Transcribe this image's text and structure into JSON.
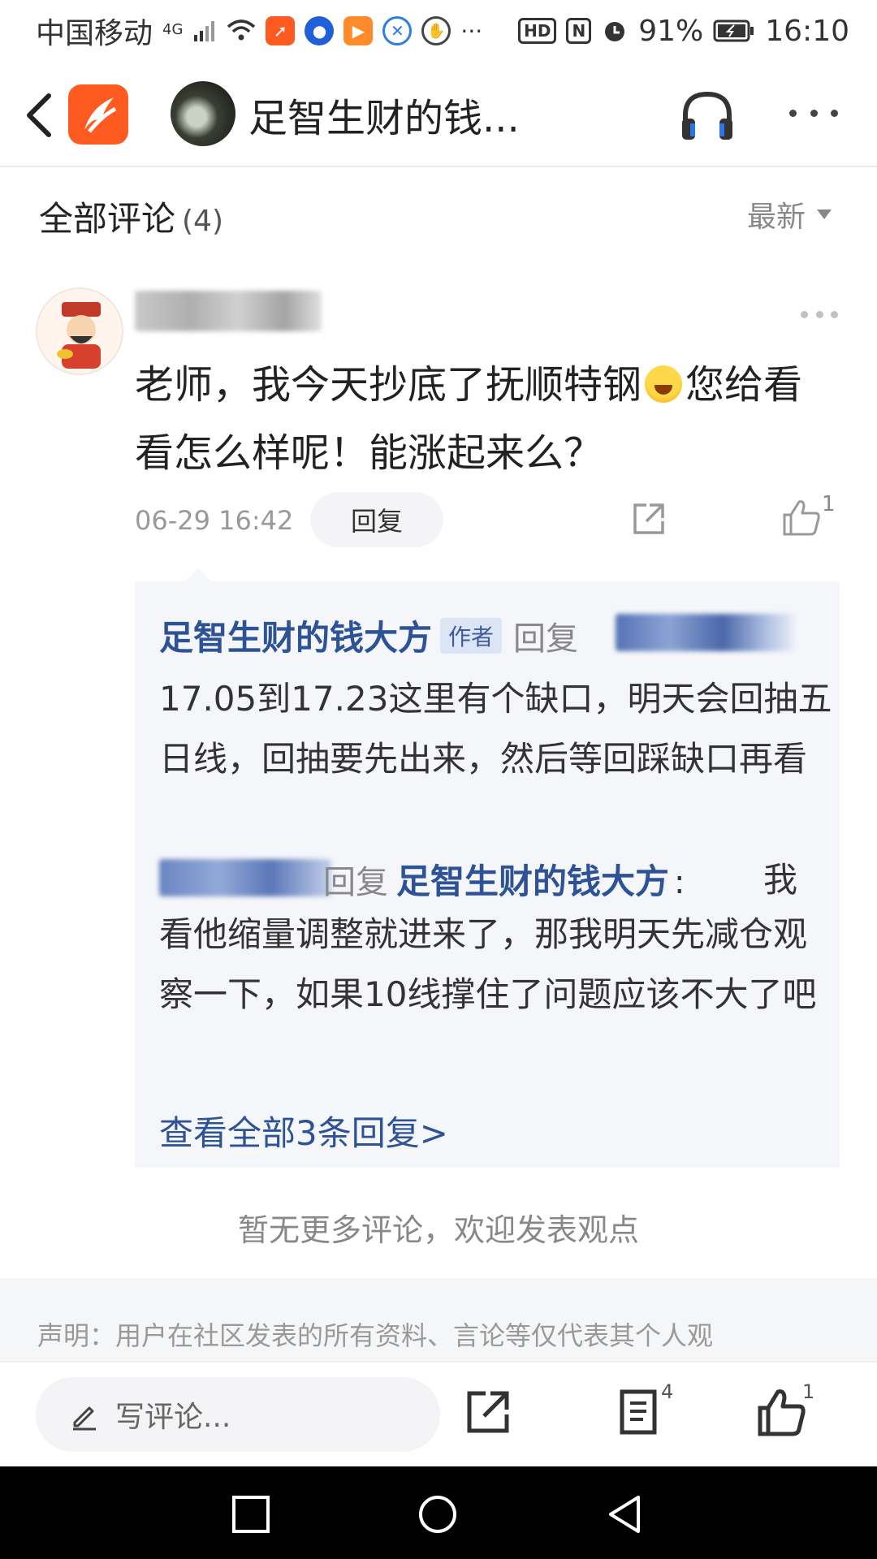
{
  "status_bar": {
    "carrier": "中国移动",
    "network": "4G",
    "more": "···",
    "hd_badge": "HD",
    "battery": "91%",
    "time": "16:10"
  },
  "nav": {
    "title": "足智生财的钱..."
  },
  "comments": {
    "header": "全部评论",
    "count": "(4)",
    "sort_label": "最新"
  },
  "comment": {
    "text_part1": "老师，我今天抄底了抚顺特钢",
    "text_part2": "您给看看怎么样呢！能涨起来么？",
    "time": "06-29 16:42",
    "reply_label": "回复",
    "like_count": "1"
  },
  "replies": {
    "reply1": {
      "author": "足智生财的钱大方",
      "author_tag": "作者",
      "reply_word": "回复",
      "text": "17.05到17.23这里有个缺口，明天会回抽五日线，回抽要先出来，然后等回踩缺口再看"
    },
    "reply2": {
      "reply_word": "回复",
      "target": "足智生财的钱大方",
      "colon": ":",
      "text_first": "我",
      "text": "看他缩量调整就进来了，那我明天先减仓观察一下，如果10线撑住了问题应该不大了吧"
    },
    "view_all": "查看全部3条回复>"
  },
  "no_more": "暂无更多评论，欢迎发表观点",
  "disclaimer": "声明：用户在社区发表的所有资料、言论等仅代表其个人观",
  "action_bar": {
    "input_placeholder": "写评论...",
    "comment_count": "4",
    "like_count": "1"
  },
  "colors": {
    "link_blue": "#2d5296",
    "brand_orange": "#ff5a1f",
    "reply_bg": "#f5f6fa"
  }
}
